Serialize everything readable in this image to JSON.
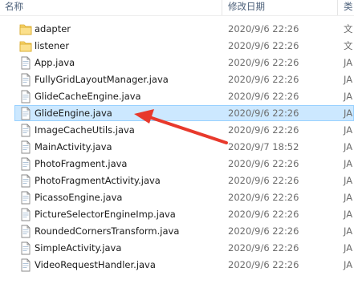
{
  "header": {
    "name_col": "名称",
    "date_col": "修改日期",
    "type_col": "类"
  },
  "rows": [
    {
      "name": "adapter",
      "date": "2020/9/6 22:26",
      "type": "文",
      "icon": "folder-icon"
    },
    {
      "name": "listener",
      "date": "2020/9/6 22:26",
      "type": "文",
      "icon": "folder-icon"
    },
    {
      "name": "App.java",
      "date": "2020/9/6 22:26",
      "type": "JA",
      "icon": "java-file-icon"
    },
    {
      "name": "FullyGridLayoutManager.java",
      "date": "2020/9/6 22:26",
      "type": "JA",
      "icon": "java-file-icon"
    },
    {
      "name": "GlideCacheEngine.java",
      "date": "2020/9/6 22:26",
      "type": "JA",
      "icon": "java-file-icon"
    },
    {
      "name": "GlideEngine.java",
      "date": "2020/9/6 22:26",
      "type": "JA",
      "icon": "java-file-icon",
      "selected": true
    },
    {
      "name": "ImageCacheUtils.java",
      "date": "2020/9/6 22:26",
      "type": "JA",
      "icon": "java-file-icon"
    },
    {
      "name": "MainActivity.java",
      "date": "2020/9/7 18:52",
      "type": "JA",
      "icon": "java-file-icon"
    },
    {
      "name": "PhotoFragment.java",
      "date": "2020/9/6 22:26",
      "type": "JA",
      "icon": "java-file-icon"
    },
    {
      "name": "PhotoFragmentActivity.java",
      "date": "2020/9/6 22:26",
      "type": "JA",
      "icon": "java-file-icon"
    },
    {
      "name": "PicassoEngine.java",
      "date": "2020/9/6 22:26",
      "type": "JA",
      "icon": "java-file-icon"
    },
    {
      "name": "PictureSelectorEngineImp.java",
      "date": "2020/9/6 22:26",
      "type": "JA",
      "icon": "java-file-icon"
    },
    {
      "name": "RoundedCornersTransform.java",
      "date": "2020/9/6 22:26",
      "type": "JA",
      "icon": "java-file-icon"
    },
    {
      "name": "SimpleActivity.java",
      "date": "2020/9/6 22:26",
      "type": "JA",
      "icon": "java-file-icon"
    },
    {
      "name": "VideoRequestHandler.java",
      "date": "2020/9/6 22:26",
      "type": "JA",
      "icon": "java-file-icon"
    }
  ],
  "colors": {
    "selection_fill": "#cce8ff",
    "selection_border": "#99d1ff",
    "arrow": "#e8392c",
    "folder": "#f7d36b"
  }
}
